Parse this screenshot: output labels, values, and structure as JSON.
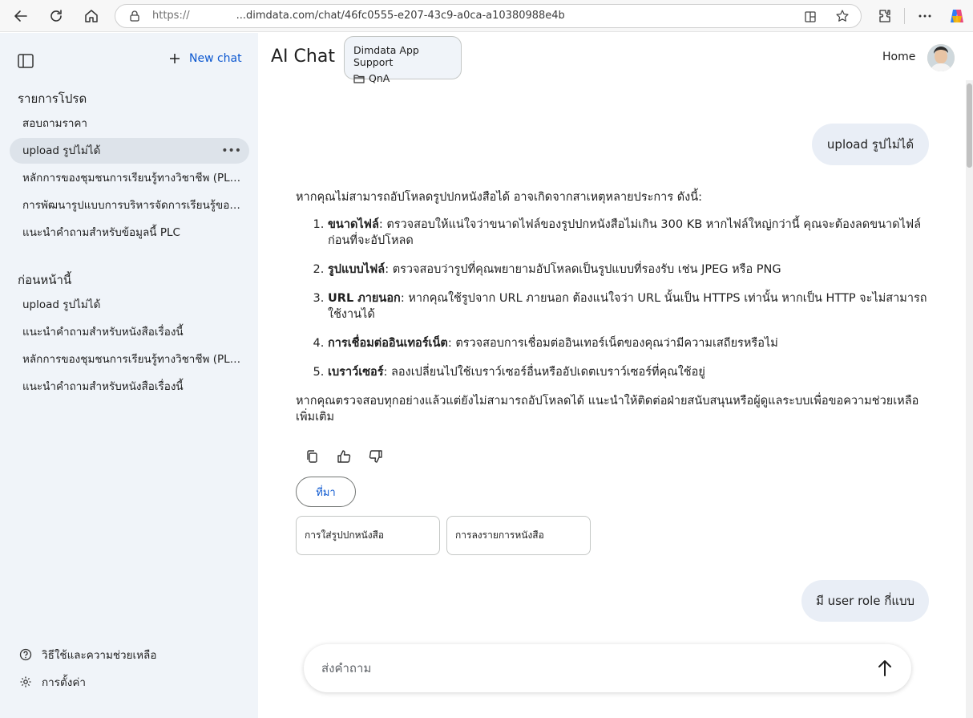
{
  "browser": {
    "url_prefix": "https://",
    "url_hidden": " ",
    "url_domain": "...dimdata.com/chat/46fc0555-e207-43c9-a0ca-a10380988e4b"
  },
  "sidebar": {
    "new_chat_label": "New chat",
    "favorites_title": "รายการโปรด",
    "favorites": [
      "สอบถามราคา",
      "upload รูปไม่ได้",
      "หลักการของชุมชนการเรียนรู้ทางวิชาชีพ (PLC)",
      "การพัฒนารูปแบบการบริหารจัดการเรียนรู้ของโรงเรียน",
      "แนะนำคำถามสำหรับข้อมูลนี้ PLC"
    ],
    "previous_title": "ก่อนหน้านี้",
    "previous": [
      "upload รูปไม่ได้",
      "แนะนำคำถามสำหรับหนังสือเรื่องนี้",
      "หลักการของชุมชนการเรียนรู้ทางวิชาชีพ (PLC)",
      "แนะนำคำถามสำหรับหนังสือเรื่องนี้"
    ],
    "help_label": "วิธีใช้และความช่วยเหลือ",
    "settings_label": "การตั้งค่า"
  },
  "header": {
    "title": "AI Chat",
    "context_name": "Dimdata App Support",
    "context_folder": "QnA",
    "home_label": "Home"
  },
  "chat": {
    "user_msg_1": "upload รูปไม่ได้",
    "answer_intro": "หากคุณไม่สามารถอัปโหลดรูปปกหนังสือได้ อาจเกิดจากสาเหตุหลายประการ ดังนี้:",
    "answer_items": [
      {
        "title": "ขนาดไฟล์",
        "text": ": ตรวจสอบให้แน่ใจว่าขนาดไฟล์ของรูปปกหนังสือไม่เกิน 300 KB หากไฟล์ใหญ่กว่านี้ คุณจะต้องลดขนาดไฟล์ก่อนที่จะอัปโหลด"
      },
      {
        "title": "รูปแบบไฟล์",
        "text": ": ตรวจสอบว่ารูปที่คุณพยายามอัปโหลดเป็นรูปแบบที่รองรับ เช่น JPEG หรือ PNG"
      },
      {
        "title": "URL ภายนอก",
        "text": ": หากคุณใช้รูปจาก URL ภายนอก ต้องแน่ใจว่า URL นั้นเป็น HTTPS เท่านั้น หากเป็น HTTP จะไม่สามารถใช้งานได้"
      },
      {
        "title": "การเชื่อมต่ออินเทอร์เน็ต",
        "text": ": ตรวจสอบการเชื่อมต่ออินเทอร์เน็ตของคุณว่ามีความเสถียรหรือไม่"
      },
      {
        "title": "เบราว์เซอร์",
        "text": ": ลองเปลี่ยนไปใช้เบราว์เซอร์อื่นหรืออัปเดตเบราว์เซอร์ที่คุณใช้อยู่"
      }
    ],
    "answer_outro": "หากคุณตรวจสอบทุกอย่างแล้วแต่ยังไม่สามารถอัปโหลดได้ แนะนำให้ติดต่อฝ่ายสนับสนุนหรือผู้ดูแลระบบเพื่อขอความช่วยเหลือเพิ่มเติม",
    "source_label": "ที่มา",
    "source_cards": [
      "การใส่รูปปกหนังสือ",
      "การลงรายการหนังสือ"
    ],
    "user_msg_2": "มี user role กี่แบบ"
  },
  "composer": {
    "placeholder": "ส่งคำถาม"
  }
}
